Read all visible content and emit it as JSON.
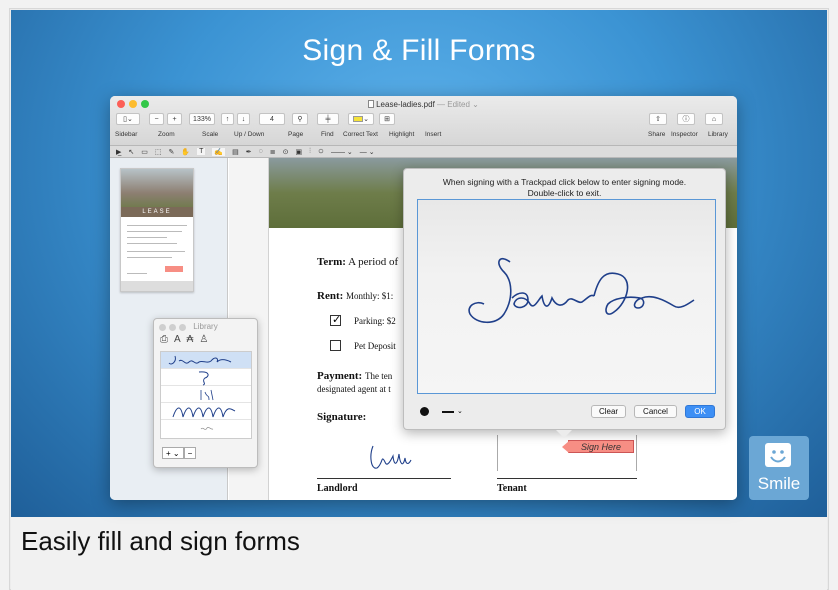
{
  "banner": {
    "title": "Sign & Fill Forms"
  },
  "caption": "Easily fill and sign forms",
  "window": {
    "filename": "Lease-ladies.pdf",
    "status": "— Edited ⌄",
    "toolbar": {
      "zoom_value": "133%",
      "page_value": "4",
      "labels": {
        "sidebar": "Sidebar",
        "zoom": "Zoom",
        "scale": "Scale",
        "updown": "Up / Down",
        "page": "Page",
        "find": "Find",
        "correct_text": "Correct Text",
        "highlight": "Highlight",
        "insert": "Insert",
        "share": "Share",
        "inspector": "Inspector",
        "library": "Library"
      }
    }
  },
  "thumbnail": {
    "word": "LEASE"
  },
  "library_panel": {
    "title": "Library",
    "add_label": "+ ⌄",
    "remove_label": "−"
  },
  "document": {
    "term_label": "Term:",
    "term_text": "A period of",
    "rent_label": "Rent:",
    "rent_text": "Monthly: $1:",
    "parking_text": "Parking: $2",
    "pet_text": "Pet Deposit",
    "payment_label": "Payment:",
    "payment_text": "The ten",
    "payment_line2": "designated agent at t",
    "signature_label": "Signature:",
    "landlord_label": "Landlord",
    "tenant_label": "Tenant"
  },
  "signing": {
    "instructions_line1": "When signing with a Trackpad click below to enter signing mode.",
    "instructions_line2": "Double-click to exit.",
    "clear_label": "Clear",
    "cancel_label": "Cancel",
    "ok_label": "OK"
  },
  "sign_here": "Sign Here",
  "logo_text": "Smile",
  "colors": {
    "banner": "#3b93d3",
    "ok_button": "#3d8ff5",
    "sign_here": "#f78e84",
    "ink": "#1f3f8a"
  }
}
